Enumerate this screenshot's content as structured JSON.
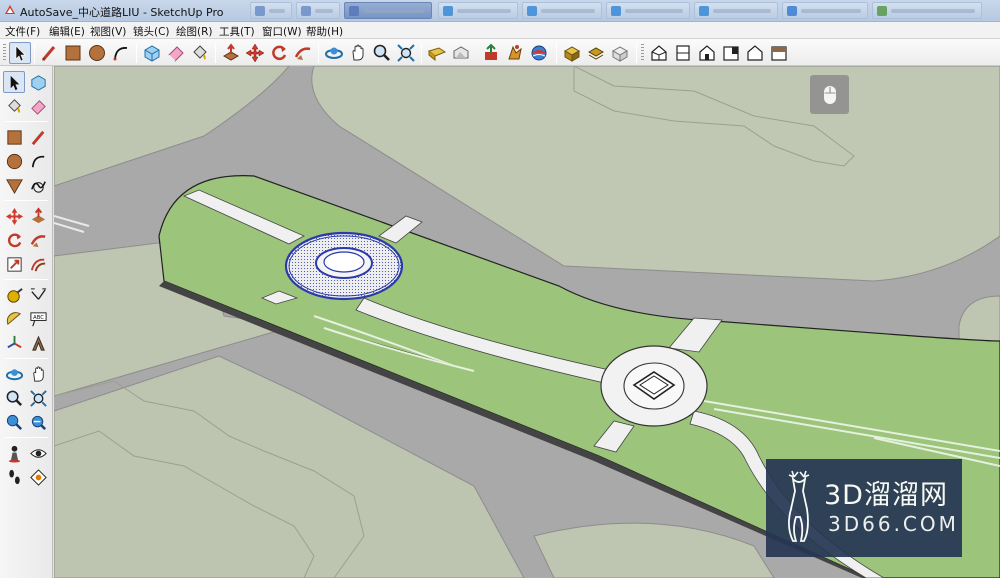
{
  "window": {
    "title": "AutoSave_中心道路LIU - SketchUp Pro",
    "taskbar_tabs": [
      {
        "icon_color": "#6e8fc8",
        "active": false
      },
      {
        "icon_color": "#6e8fc8",
        "active": false
      },
      {
        "icon_color": "#4d6fb5",
        "active": true
      },
      {
        "icon_color": "#3b8bd9",
        "active": false
      },
      {
        "icon_color": "#3b8bd9",
        "active": false
      },
      {
        "icon_color": "#3b8bd9",
        "active": false
      },
      {
        "icon_color": "#3b8bd9",
        "active": false
      },
      {
        "icon_color": "#3c7fd6",
        "active": false
      },
      {
        "icon_color": "#5a9a4a",
        "active": false
      }
    ]
  },
  "menu": {
    "items": [
      "文件(F)",
      "编辑(E)",
      "视图(V)",
      "镜头(C)",
      "绘图(R)",
      "工具(T)",
      "窗口(W)",
      "帮助(H)"
    ]
  },
  "toolbar_top": {
    "tools": [
      "select-icon",
      "line-icon",
      "rectangle-icon",
      "circle-icon",
      "arc-icon",
      "make-component-icon",
      "eraser-icon",
      "paint-bucket-icon",
      "push-pull-icon",
      "move-icon",
      "rotate-icon",
      "follow-me-icon",
      "orbit-icon",
      "pan-icon",
      "zoom-icon",
      "zoom-extents-icon",
      "materials-icon",
      "warehouse-icon",
      "send-to-layout-icon",
      "extension-warehouse-icon",
      "components-icon",
      "iso-view-icon",
      "top-view-icon",
      "front-view-icon",
      "right-view-icon",
      "back-view-icon",
      "left-view-icon"
    ]
  },
  "toolbar_left": {
    "tools": [
      "select-icon",
      "make-component-icon",
      "paint-bucket-icon",
      "eraser-icon",
      "rectangle-icon",
      "line-icon",
      "circle-icon",
      "arc-icon",
      "polygon-icon",
      "freehand-icon",
      "move-icon",
      "push-pull-icon",
      "rotate-icon",
      "follow-me-icon",
      "scale-icon",
      "offset-icon",
      "tape-measure-icon",
      "dimension-icon",
      "protractor-icon",
      "text-icon",
      "axes-icon",
      "3d-text-icon",
      "orbit-icon",
      "pan-icon",
      "zoom-icon",
      "zoom-window-icon",
      "zoom-extents-icon",
      "previous-view-icon",
      "position-camera-icon",
      "look-around-icon",
      "walk-icon",
      "section-plane-icon"
    ],
    "text_tool_label": "ABC"
  },
  "viewport": {
    "badge_icon": "mouse-icon"
  },
  "watermark": {
    "title": "3D溜溜网",
    "subtitle": "3D66.COM"
  },
  "colors": {
    "lawn": "#9cc47b",
    "ground": "#bec6b1",
    "road": "#a8a8a8",
    "walkway": "#f0f0f0",
    "selection": "#2b3aa8",
    "watermark_bg": "#263653"
  }
}
